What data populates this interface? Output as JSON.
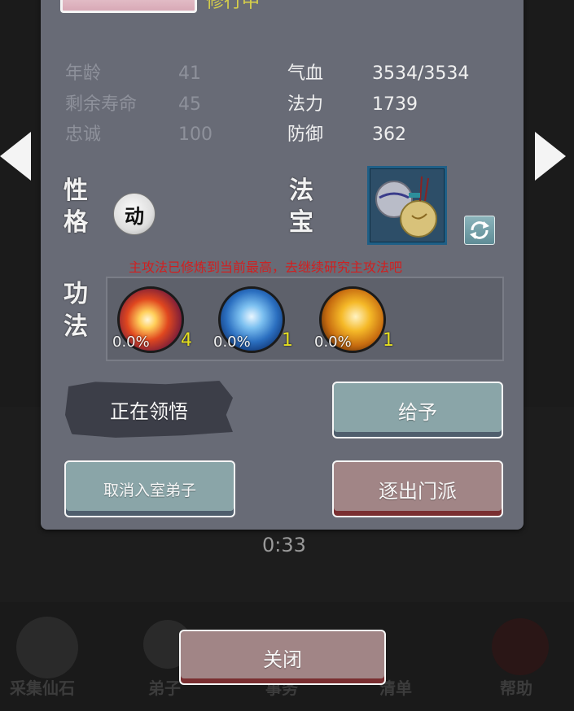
{
  "character": {
    "status": "修行中",
    "stats_left": [
      {
        "label": "年龄",
        "value": "41"
      },
      {
        "label": "剩余寿命",
        "value": "45"
      },
      {
        "label": "忠诚",
        "value": "100"
      }
    ],
    "stats_right": [
      {
        "label": "气血",
        "value": "3534/3534"
      },
      {
        "label": "法力",
        "value": "1739"
      },
      {
        "label": "防御",
        "value": "362"
      }
    ]
  },
  "labels": {
    "personality": [
      "性",
      "格"
    ],
    "treasure": [
      "法",
      "宝"
    ],
    "skills": [
      "功",
      "法"
    ]
  },
  "personality_badge": "动",
  "warning": "主攻法已修炼到当前最高，去继续研究主攻法吧",
  "skills": [
    {
      "icon": "fire-burst-icon",
      "progress": "0.0%",
      "level": "4"
    },
    {
      "icon": "ice-blade-icon",
      "progress": "0.0%",
      "level": "1"
    },
    {
      "icon": "golden-fist-icon",
      "progress": "0.0%",
      "level": "1"
    }
  ],
  "buttons": {
    "comprehending": "正在领悟",
    "give": "给予",
    "cancel_disciple": "取消入室弟子",
    "expel": "逐出门派",
    "close": "关闭"
  },
  "background": {
    "timer": "0:33",
    "nav": [
      "采集仙石",
      "弟子",
      "事务",
      "清单",
      "帮助"
    ]
  },
  "colors": {
    "dialog": "#686b76",
    "status_yellow": "#d8d04a",
    "warning_red": "#d21f1f",
    "level_yellow": "#e6e020",
    "button_teal": "#8aa5a8",
    "button_rose": "#a18586"
  }
}
